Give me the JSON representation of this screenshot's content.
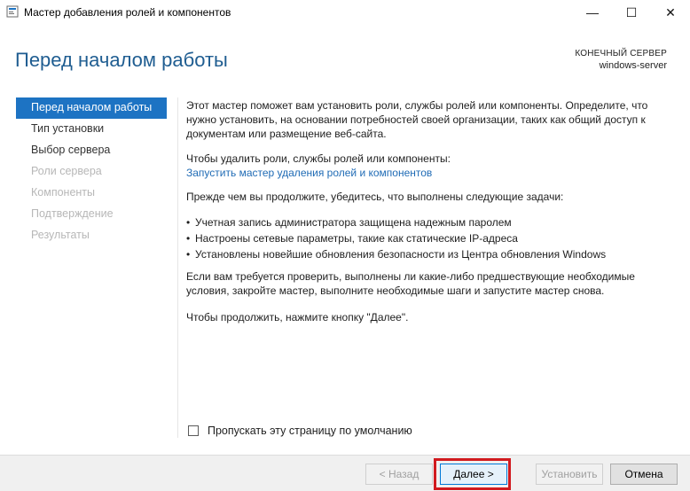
{
  "window": {
    "title": "Мастер добавления ролей и компонентов",
    "minimize_glyph": "—",
    "maximize_glyph": "☐",
    "close_glyph": "✕",
    "accent_color": "#1d73c3"
  },
  "header": {
    "page_title": "Перед началом работы",
    "destination_label": "КОНЕЧНЫЙ СЕРВЕР",
    "destination_value": "windows-server"
  },
  "nav": {
    "items": [
      {
        "label": "Перед началом работы",
        "state": "active"
      },
      {
        "label": "Тип установки",
        "state": "enabled"
      },
      {
        "label": "Выбор сервера",
        "state": "enabled"
      },
      {
        "label": "Роли сервера",
        "state": "disabled"
      },
      {
        "label": "Компоненты",
        "state": "disabled"
      },
      {
        "label": "Подтверждение",
        "state": "disabled"
      },
      {
        "label": "Результаты",
        "state": "disabled"
      }
    ]
  },
  "content": {
    "intro": "Этот мастер поможет вам установить роли, службы ролей или компоненты. Определите, что нужно установить, на основании потребностей своей организации, таких как общий доступ к документам или размещение веб-сайта.",
    "remove_prompt": "Чтобы удалить роли, службы ролей или компоненты:",
    "remove_link": "Запустить мастер удаления ролей и компонентов",
    "before_continue": "Прежде чем вы продолжите, убедитесь, что выполнены следующие задачи:",
    "bullet_glyph": "•",
    "tasks": [
      "Учетная запись администратора защищена надежным паролем",
      "Настроены сетевые параметры, такие как статические IP-адреса",
      "Установлены новейшие обновления безопасности из Центра обновления Windows"
    ],
    "verify_note": "Если вам требуется проверить, выполнены ли какие-либо предшествующие необходимые условия, закройте мастер, выполните необходимые шаги и запустите мастер снова.",
    "continue_note": "Чтобы продолжить, нажмите кнопку \"Далее\"."
  },
  "skip_checkbox": {
    "label": "Пропускать эту страницу по умолчанию",
    "checked": false
  },
  "footer": {
    "prev_label": "< Назад",
    "next_label": "Далее >",
    "install_label": "Установить",
    "cancel_label": "Отмена",
    "highlight_color": "#d11a1f"
  }
}
